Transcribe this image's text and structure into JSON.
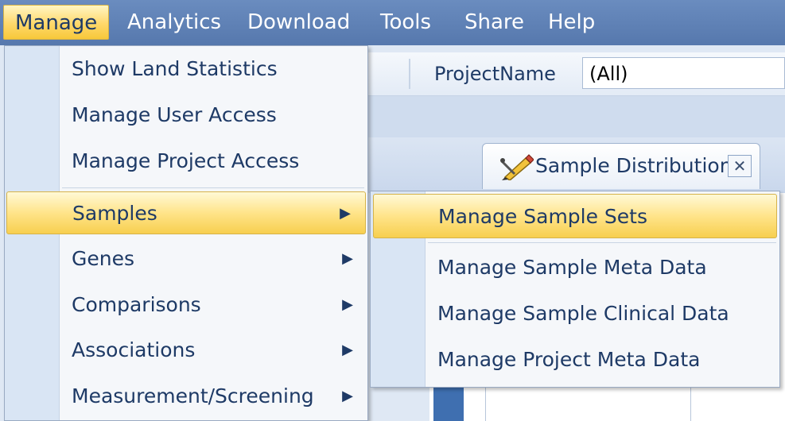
{
  "menubar": {
    "items": [
      "Manage",
      "Analytics",
      "Download",
      "Tools",
      "Share",
      "Help"
    ]
  },
  "toolbar": {
    "filter_label": "ProjectName",
    "filter_value": "(All)"
  },
  "document_tab": {
    "label": "Sample Distribution",
    "close_glyph": "✕",
    "icon": "pencil-ruler-icon"
  },
  "manage_menu": {
    "items": [
      {
        "label": "Show Land Statistics"
      },
      {
        "label": "Manage User Access"
      },
      {
        "label": "Manage Project Access"
      },
      {
        "label": "Samples",
        "submenu": true
      },
      {
        "label": "Genes",
        "submenu": true
      },
      {
        "label": "Comparisons",
        "submenu": true
      },
      {
        "label": "Associations",
        "submenu": true
      },
      {
        "label": "Measurement/Screening",
        "submenu": true
      }
    ],
    "arrow_glyph": "▶"
  },
  "samples_submenu": {
    "items": [
      {
        "label": "Manage Sample Sets"
      },
      {
        "label": "Manage Sample Meta Data"
      },
      {
        "label": "Manage Sample Clinical Data"
      },
      {
        "label": "Manage Project Meta Data"
      }
    ]
  },
  "colors": {
    "menubar": "#5678ad",
    "highlight": "#ffe48a",
    "text": "#1e3a66"
  }
}
